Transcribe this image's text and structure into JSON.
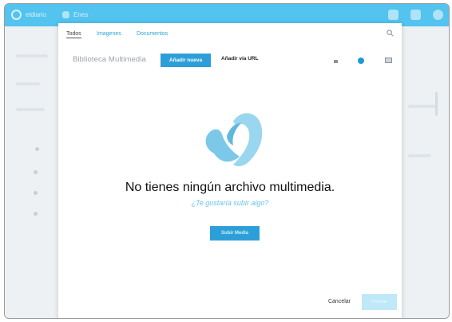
{
  "topbar": {
    "site_name": "eldiario",
    "section": "Enes",
    "icons": [
      "brush-icon",
      "grid-icon",
      "settings-icon"
    ]
  },
  "modal": {
    "tabs": [
      {
        "label": "Todos",
        "active": true
      },
      {
        "label": "Imagenes",
        "active": false
      },
      {
        "label": "Documentos",
        "active": false
      }
    ],
    "search_icon": "search-icon",
    "library_title": "Biblioteca Multimedia",
    "add_new_label": "Añadir nueva",
    "add_url_label": "Añadir vía URL",
    "view_icons": [
      "list-view-icon",
      "toggle-icon",
      "grid-view-icon"
    ],
    "empty_icon": "media-empty-icon",
    "empty_message": "No tienes ningún archivo multimedia.",
    "empty_prompt": "¿Te gustaría subir algo?",
    "upload_label": "Subir Media",
    "cancel_label": "Cancelar",
    "insert_label": "Insertar"
  },
  "colors": {
    "accent": "#2d9fd8",
    "topbar": "#53c3ef",
    "link": "#4cb9e6"
  }
}
